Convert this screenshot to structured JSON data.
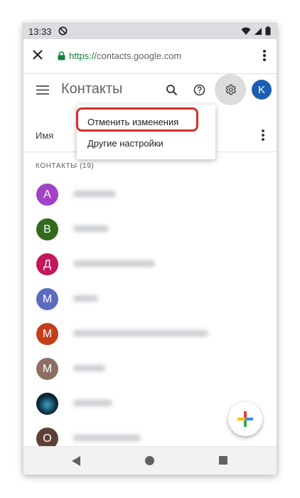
{
  "status_bar": {
    "time": "13:33"
  },
  "browser": {
    "url_scheme": "https://",
    "url_host": "contacts.google.com"
  },
  "app_bar": {
    "title": "Контакты",
    "avatar_letter": "K",
    "avatar_color": "#1a5fb4"
  },
  "column_header": {
    "label": "Имя"
  },
  "section": {
    "label": "КОНТАКТЫ (19)"
  },
  "contacts": [
    {
      "letter": "А",
      "color": "#a142c7"
    },
    {
      "letter": "В",
      "color": "#33691e"
    },
    {
      "letter": "Д",
      "color": "#c2185b"
    },
    {
      "letter": "М",
      "color": "#5c6bc0"
    },
    {
      "letter": "М",
      "color": "#c43e1c"
    },
    {
      "letter": "М",
      "color": "#8d6e63"
    },
    {
      "letter": "",
      "color": "#0d2b3a"
    },
    {
      "letter": "О",
      "color": "#5d4037"
    }
  ],
  "menu": {
    "items": [
      "Отменить изменения",
      "Другие настройки"
    ],
    "highlight_color": "#d32f2f"
  },
  "icons": {
    "close": "close-icon",
    "lock": "lock-icon",
    "more": "more-vert-icon",
    "menu": "hamburger-menu-icon",
    "search": "search-icon",
    "help": "help-icon",
    "settings": "gear-icon",
    "add": "plus-icon"
  }
}
